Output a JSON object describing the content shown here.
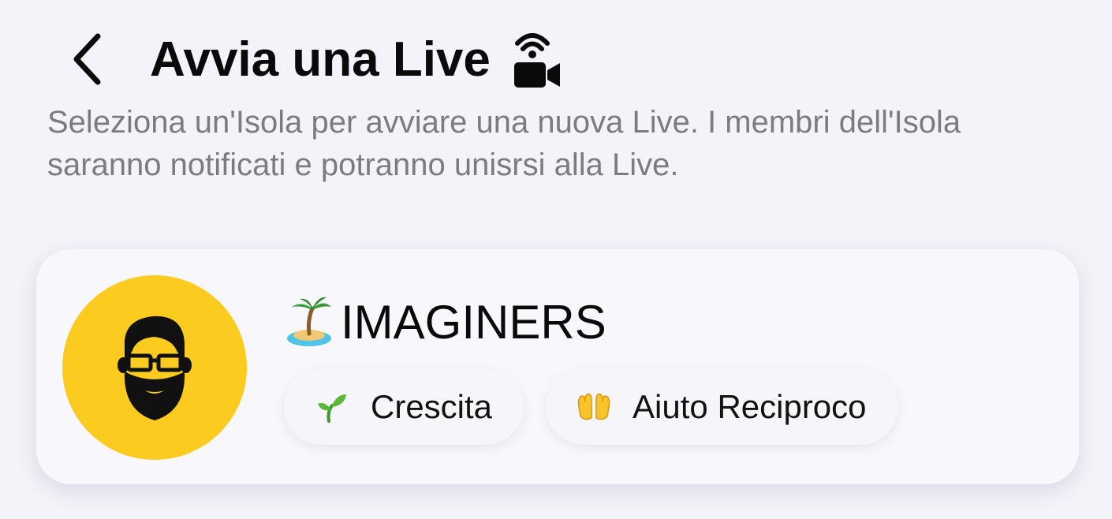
{
  "header": {
    "title": "Avvia una Live",
    "back_icon": "chevron-left-icon",
    "title_icon": "live-camera-icon"
  },
  "subtitle": "Seleziona un'Isola per avviare una nuova Live. I membri dell'Isola saranno notificati e potranno unisrsi alla Live.",
  "island_card": {
    "name": "IMAGINERS",
    "name_emoji": "island-emoji",
    "avatar": "bearded-man-avatar",
    "avatar_color": "#fccb1f",
    "tags": [
      {
        "emoji": "seedling-emoji",
        "label": "Crescita"
      },
      {
        "emoji": "open-hands-emoji",
        "label": "Aiuto Reciproco"
      }
    ]
  },
  "colors": {
    "background": "#f3f3fa",
    "card": "#f8f8fc",
    "subtitle_text": "#7b7b82"
  }
}
